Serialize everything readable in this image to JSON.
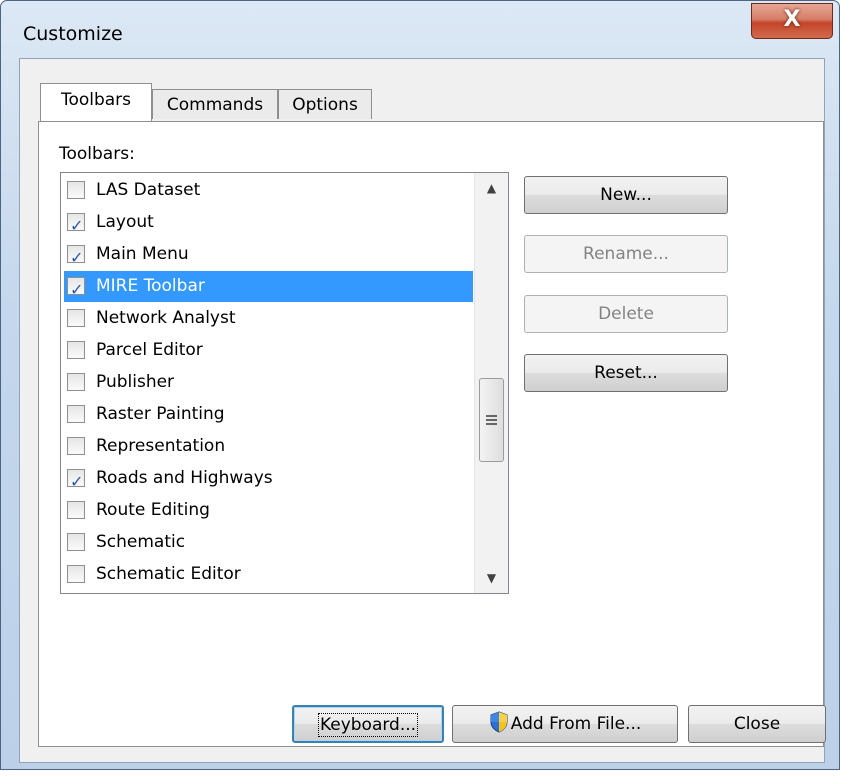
{
  "window": {
    "title": "Customize",
    "close_glyph": "X"
  },
  "tabs": [
    {
      "label": "Toolbars",
      "active": true
    },
    {
      "label": "Commands",
      "active": false
    },
    {
      "label": "Options",
      "active": false
    }
  ],
  "toolbars_label": "Toolbars:",
  "toolbars": [
    {
      "label": "LAS Dataset",
      "checked": false,
      "selected": false
    },
    {
      "label": "Layout",
      "checked": true,
      "selected": false
    },
    {
      "label": "Main Menu",
      "checked": true,
      "selected": false
    },
    {
      "label": "MIRE Toolbar",
      "checked": true,
      "selected": true
    },
    {
      "label": "Network Analyst",
      "checked": false,
      "selected": false
    },
    {
      "label": "Parcel Editor",
      "checked": false,
      "selected": false
    },
    {
      "label": "Publisher",
      "checked": false,
      "selected": false
    },
    {
      "label": "Raster Painting",
      "checked": false,
      "selected": false
    },
    {
      "label": "Representation",
      "checked": false,
      "selected": false
    },
    {
      "label": "Roads and Highways",
      "checked": true,
      "selected": false
    },
    {
      "label": "Route Editing",
      "checked": false,
      "selected": false
    },
    {
      "label": "Schematic",
      "checked": false,
      "selected": false
    },
    {
      "label": "Schematic Editor",
      "checked": false,
      "selected": false
    }
  ],
  "side_buttons": {
    "new": {
      "label": "New...",
      "enabled": true
    },
    "rename": {
      "label": "Rename...",
      "enabled": false
    },
    "delete": {
      "label": "Delete",
      "enabled": false
    },
    "reset": {
      "label": "Reset...",
      "enabled": true
    }
  },
  "footer_buttons": {
    "keyboard": "Keyboard...",
    "add_from_file": "Add From File...",
    "close": "Close"
  },
  "icons": {
    "shield": "uac-shield-icon",
    "check": "✓"
  },
  "colors": {
    "selection": "#3399ff",
    "close_button": "#c4452a",
    "window_frame": "#bcd1e8"
  }
}
